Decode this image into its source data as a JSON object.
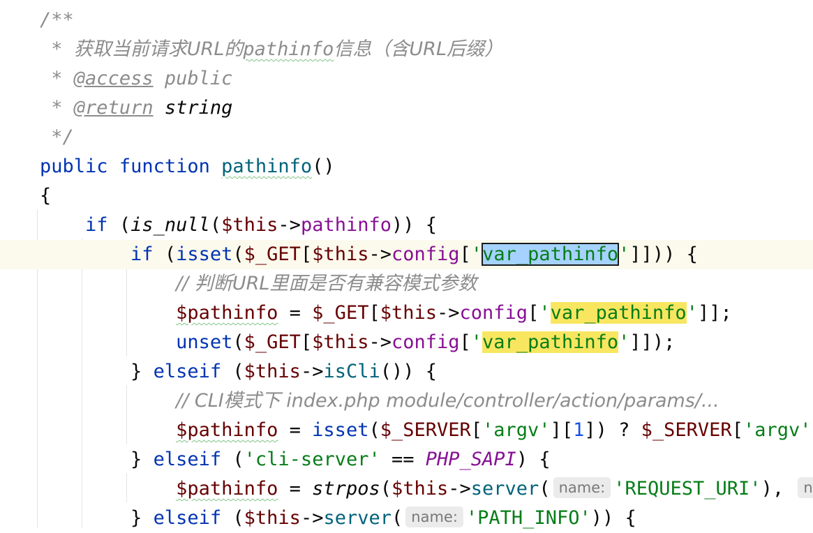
{
  "lines": [
    "/**",
    "* 获取当前请求URL的pathinfo信息（含URL后缀）",
    "* @access public",
    "* @return string",
    "*/",
    "public function pathinfo()",
    "{",
    "if (is_null($this->pathinfo)) {",
    "if (isset($_GET[$this->config['var_pathinfo']])) {",
    "// 判断URL里面是否有兼容模式参数",
    "$pathinfo = $_GET[$this->config['var_pathinfo']];",
    "unset($_GET[$this->config['var_pathinfo']]);",
    "} elseif ($this->isCli()) {",
    "// CLI模式下 index.php module/controller/action/params/...",
    "$pathinfo = isset($_SERVER['argv'][1]) ? $_SERVER['argv']",
    "} elseif ('cli-server' == PHP_SAPI) {",
    "$pathinfo = strpos($this->server(name: 'REQUEST_URI'), ne",
    "} elseif ($this->server(name: 'PATH_INFO')) {"
  ],
  "tok": {
    "c_open": "/**",
    "c_star": "*",
    "c_desc": "获取当前请求URL的",
    "c_desc_word": "pathinfo",
    "c_desc_tail": "信息（含URL后缀）",
    "c_access_tag": "@access",
    "c_access_val": "public",
    "c_return_tag": "@return",
    "c_return_val": "string",
    "c_close": "*/",
    "kw_public": "public",
    "kw_function": "function",
    "fn_pathinfo": "pathinfo",
    "paren_open_close": "()",
    "brace_open": "{",
    "brace_close": "}",
    "kw_if": "if",
    "kw_elseif": "elseif",
    "paren_open": "(",
    "fn_is_null": "is_null",
    "this": "$this",
    "arrow": "->",
    "prop_pathinfo": "pathinfo",
    "close_if_1": ")) {",
    "fn_isset": "isset",
    "get": "$_GET",
    "bracket_open": "[",
    "prop_config": "config",
    "quote": "'",
    "str_var_pathinfo": "var_pathinfo",
    "close_if_2": "]])) {",
    "cmt_check": "// 判断URL里面是否有兼容模式参数",
    "var_pathinfo": "$pathinfo",
    "assign": " = ",
    "end_assign_1": "]];",
    "fn_unset": "unset",
    "end_unset": "]]);",
    "fn_isCli": "isCli",
    "close_isCli": "()) {",
    "cmt_cli": "// CLI模式下 index.php module/controller/action/params/...",
    "server": "$_SERVER",
    "str_argv": "'argv'",
    "num_1": "1",
    "ternary_mid": "]) ? ",
    "close_br_1": "][",
    "close_br_2": "]",
    "str_cli_server": "'cli-server'",
    "op_eq": " == ",
    "const_sapi": "PHP_SAPI",
    "close_paren_brace": ") {",
    "fn_strpos": "strpos",
    "fn_server": "server",
    "hint_name": "name:",
    "str_request_uri": "'REQUEST_URI'",
    "comma_close": "), ",
    "hint_trunc": "ne",
    "str_path_info": "'PATH_INFO'",
    "close_pathinfo": ")) {"
  }
}
